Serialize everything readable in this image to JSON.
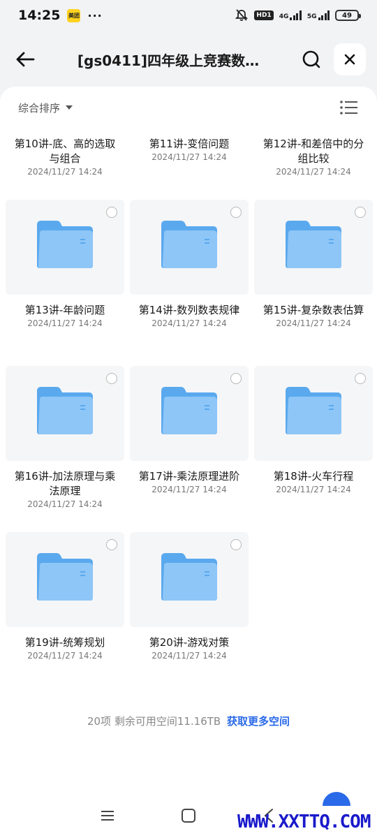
{
  "status": {
    "time": "14:25",
    "app_badge": "美团",
    "dots": "···",
    "hd": "HD1",
    "net1": "4G",
    "net2": "5G",
    "battery": "49"
  },
  "header": {
    "title": "[gs0411]四年级上竞赛数…"
  },
  "toolbar": {
    "sort_label": "综合排序"
  },
  "files": [
    {
      "name": "第10讲-底、高的选取与组合",
      "date": "2024/11/27 14:24",
      "thumb": false
    },
    {
      "name": "第11讲-变倍问题",
      "date": "2024/11/27 14:24",
      "thumb": false
    },
    {
      "name": "第12讲-和差倍中的分组比较",
      "date": "2024/11/27 14:24",
      "thumb": false
    },
    {
      "name": "第13讲-年龄问题",
      "date": "2024/11/27 14:24",
      "thumb": true
    },
    {
      "name": "第14讲-数列数表规律",
      "date": "2024/11/27 14:24",
      "thumb": true
    },
    {
      "name": "第15讲-复杂数表估算",
      "date": "2024/11/27 14:24",
      "thumb": true
    },
    {
      "name": "第16讲-加法原理与乘法原理",
      "date": "2024/11/27 14:24",
      "thumb": true
    },
    {
      "name": "第17讲-乘法原理进阶",
      "date": "2024/11/27 14:24",
      "thumb": true
    },
    {
      "name": "第18讲-火车行程",
      "date": "2024/11/27 14:24",
      "thumb": true
    },
    {
      "name": "第19讲-统筹规划",
      "date": "2024/11/27 14:24",
      "thumb": true
    },
    {
      "name": "第20讲-游戏对策",
      "date": "2024/11/27 14:24",
      "thumb": true
    }
  ],
  "footer": {
    "count_text": "20项 剩余可用空间11.16TB",
    "link_text": "获取更多空间"
  },
  "watermark": "WWW.XXTTQ.COM",
  "colors": {
    "accent": "#2a6ae8",
    "folder_back": "#5aa9ee",
    "folder_front": "#8ec6f7"
  }
}
